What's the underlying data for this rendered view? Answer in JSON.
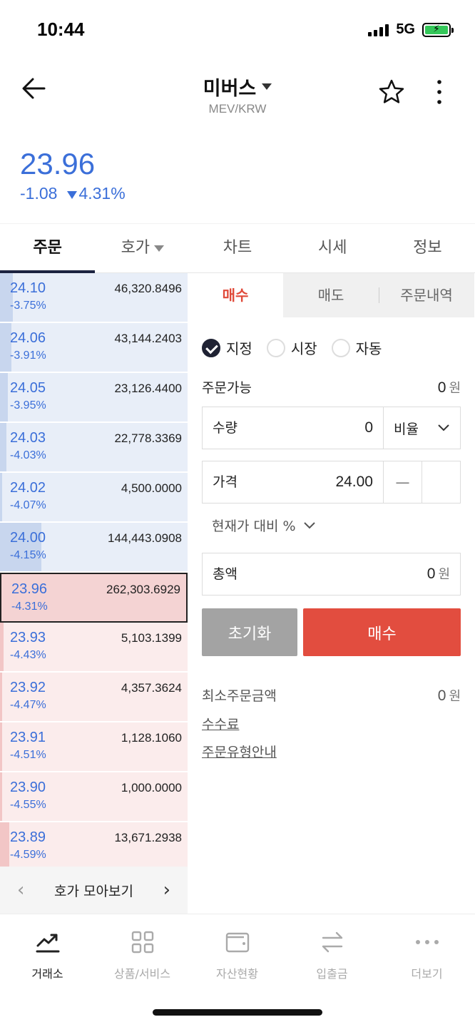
{
  "status": {
    "time": "10:44",
    "network": "5G"
  },
  "header": {
    "title": "미버스",
    "subtitle": "MEV/KRW"
  },
  "price": {
    "current": "23.96",
    "change": "-1.08",
    "change_pct": "4.31%"
  },
  "tabs": [
    {
      "label": "주문",
      "active": true
    },
    {
      "label": "호가",
      "active": false
    },
    {
      "label": "차트",
      "active": false
    },
    {
      "label": "시세",
      "active": false
    },
    {
      "label": "정보",
      "active": false
    }
  ],
  "orderbook": {
    "asks": [
      {
        "price": "24.10",
        "pct": "-3.75%",
        "volume": "46,320.8496",
        "depth": 0.07
      },
      {
        "price": "24.06",
        "pct": "-3.91%",
        "volume": "43,144.2403",
        "depth": 0.06
      },
      {
        "price": "24.05",
        "pct": "-3.95%",
        "volume": "23,126.4400",
        "depth": 0.04
      },
      {
        "price": "24.03",
        "pct": "-4.03%",
        "volume": "22,778.3369",
        "depth": 0.035
      },
      {
        "price": "24.02",
        "pct": "-4.07%",
        "volume": "4,500.0000",
        "depth": 0.01
      },
      {
        "price": "24.00",
        "pct": "-4.15%",
        "volume": "144,443.0908",
        "depth": 0.22
      }
    ],
    "current": {
      "price": "23.96",
      "pct": "-4.31%",
      "volume": "262,303.6929"
    },
    "bids": [
      {
        "price": "23.93",
        "pct": "-4.43%",
        "volume": "5,103.1399",
        "depth": 0.02
      },
      {
        "price": "23.92",
        "pct": "-4.47%",
        "volume": "4,357.3624",
        "depth": 0.01
      },
      {
        "price": "23.91",
        "pct": "-4.51%",
        "volume": "1,128.1060",
        "depth": 0.01
      },
      {
        "price": "23.90",
        "pct": "-4.55%",
        "volume": "1,000.0000",
        "depth": 0.01
      },
      {
        "price": "23.89",
        "pct": "-4.59%",
        "volume": "13,671.2938",
        "depth": 0.05
      }
    ],
    "footer_label": "호가 모아보기"
  },
  "order": {
    "subtabs": [
      "매수",
      "매도",
      "주문내역"
    ],
    "types": [
      "지정",
      "시장",
      "자동"
    ],
    "available_label": "주문가능",
    "available_value": "0",
    "currency": "원",
    "qty_label": "수량",
    "qty_value": "0",
    "ratio_label": "비율",
    "price_label": "가격",
    "price_value": "24.00",
    "minus": "—",
    "pct_compare_label": "현재가 대비 %",
    "total_label": "총액",
    "total_value": "0",
    "reset_label": "초기화",
    "buy_label": "매수",
    "min_order_label": "최소주문금액",
    "min_order_value": "0",
    "fee_link": "수수료",
    "guide_link": "주문유형안내"
  },
  "bottomnav": [
    {
      "label": "거래소",
      "icon": "chart-trend-icon",
      "active": true
    },
    {
      "label": "상품/서비스",
      "icon": "grid-icon",
      "active": false
    },
    {
      "label": "자산현황",
      "icon": "wallet-icon",
      "active": false
    },
    {
      "label": "입출금",
      "icon": "transfer-icon",
      "active": false
    },
    {
      "label": "더보기",
      "icon": "more-dots-icon",
      "active": false
    }
  ],
  "colors": {
    "blue": "#3b6fd9",
    "red": "#e24d3f",
    "navy": "#1c2340"
  }
}
